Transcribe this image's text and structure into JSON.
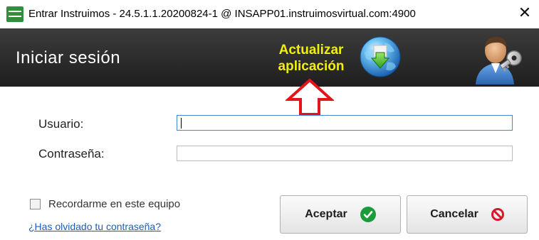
{
  "window": {
    "title": "Entrar Instruimos - 24.5.1.1.20200824-1 @ INSAPP01.instruimosvirtual.com:4900",
    "close_glyph": "✕",
    "app_icon": "instruimos-logo-icon"
  },
  "header": {
    "title": "Iniciar sesión",
    "update_label_line1": "Actualizar",
    "update_label_line2": "aplicación",
    "update_icon": "globe-download-icon",
    "user_icon": "user-key-icon",
    "background": "#2b2b2b",
    "update_label_color": "#f2ef0e"
  },
  "annotation": {
    "arrow_icon": "red-up-arrow-icon",
    "color": "#e3141c"
  },
  "form": {
    "username_label": "Usuario:",
    "username_value": "",
    "password_label": "Contraseña:",
    "password_value": "",
    "remember_label": "Recordarme en este equipo",
    "remember_checked": false,
    "forgot_link": "¿Has olvidado tu contraseña?"
  },
  "buttons": {
    "accept_label": "Aceptar",
    "accept_icon": "check-circle-icon",
    "cancel_label": "Cancelar",
    "cancel_icon": "no-entry-icon"
  }
}
